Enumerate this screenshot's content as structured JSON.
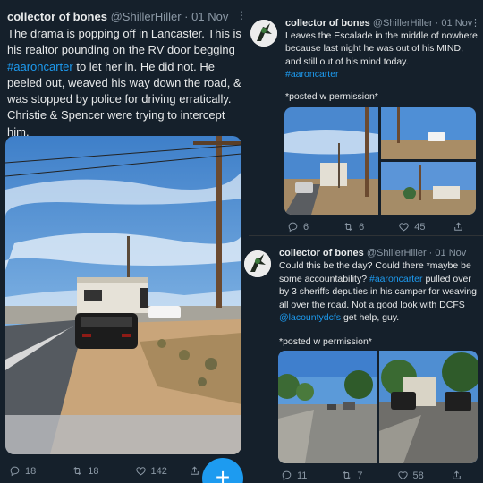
{
  "left_tweet": {
    "author": {
      "name": "collector of bones",
      "handle": "@ShillerHiller",
      "separator": "·",
      "date": "01 Nov"
    },
    "more_label": "⋮",
    "text_before": "The drama is popping off in Lancaster. This is his realtor pounding on the RV door begging ",
    "hashtag": "#aaroncarter",
    "text_after": " to let her in. He did not. He peeled out, weaved his way down the road, & was stopped by police for driving erratically. Christie & Spencer were trying to intercept him.",
    "counts": {
      "replies": "18",
      "retweets": "18",
      "likes": "142"
    },
    "fab_label": "+"
  },
  "right_top_tweet": {
    "author": {
      "name": "collector of bones",
      "handle": "@ShillerHiller",
      "separator": "·",
      "date": "01 Nov"
    },
    "more_label": "⋮",
    "text": "Leaves the Escalade in the middle of nowhere because last night he was out of his MIND, and still out of his mind today.",
    "hashtag": "#aaroncarter",
    "posted_note": "*posted w permission*",
    "counts": {
      "replies": "6",
      "retweets": "6",
      "likes": "45"
    }
  },
  "right_bottom_tweet": {
    "author": {
      "name": "collector of bones",
      "handle": "@ShillerHiller",
      "separator": "·",
      "date": "01 Nov"
    },
    "text_1": "Could this be the day? Could there *maybe be some accountability? ",
    "hashtag": "#aaroncarter",
    "text_2": " pulled over by 3 sheriffs deputies in his camper for weaving all over the road. Not a good look with DCFS ",
    "mention": "@lacountydcfs",
    "text_3": " get help, guy.",
    "posted_note": "*posted w permission*",
    "counts": {
      "replies": "11",
      "retweets": "7",
      "likes": "58"
    }
  },
  "colors": {
    "background": "#15202b",
    "text": "#e7e9ea",
    "muted": "#8b98a5",
    "accent": "#1d9bf0"
  },
  "icons": [
    "reply-icon",
    "retweet-icon",
    "like-icon",
    "share-icon",
    "more-icon",
    "compose-icon"
  ]
}
